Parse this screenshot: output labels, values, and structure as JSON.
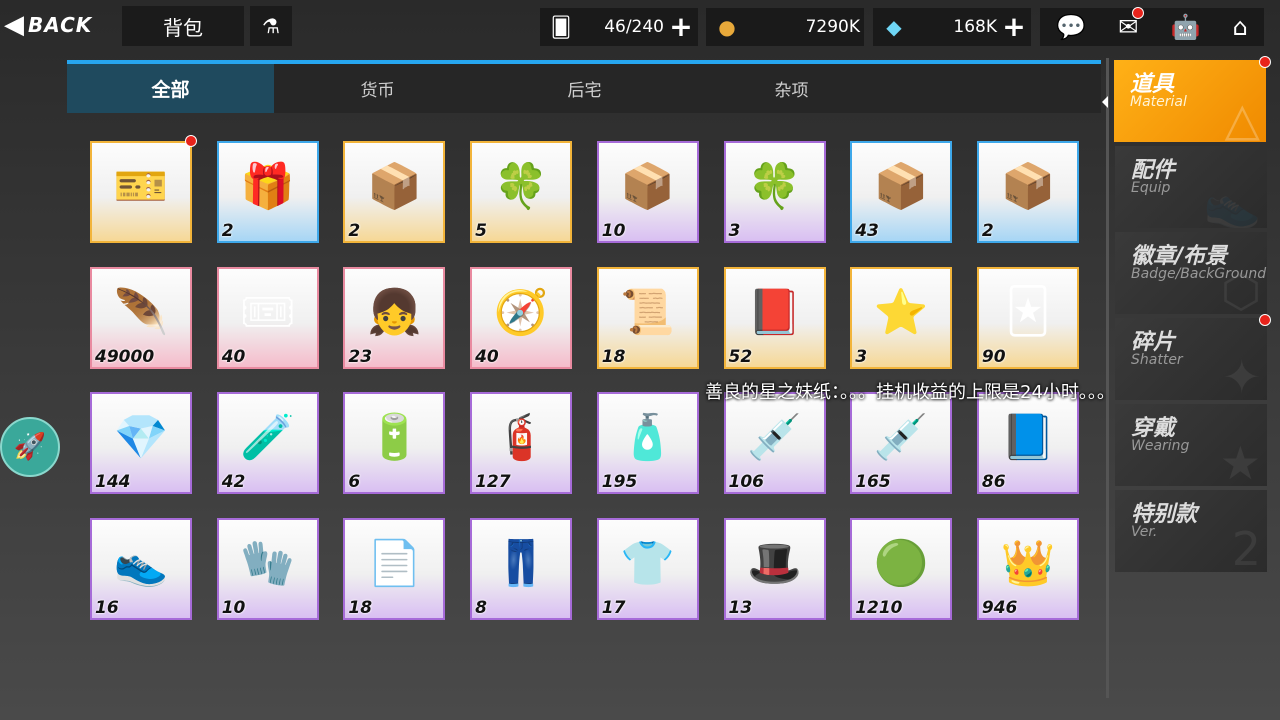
{
  "header": {
    "back_label": "BACK",
    "title": "背包",
    "flask_icon": "flask-icon"
  },
  "resources": [
    {
      "icon": "cards-icon",
      "value": "46/240"
    },
    {
      "icon": "coin-icon",
      "value": "7290K"
    },
    {
      "icon": "diamond-icon",
      "value": "168K"
    }
  ],
  "tabs": [
    {
      "label": "全部",
      "active": true
    },
    {
      "label": "货币",
      "active": false
    },
    {
      "label": "后宅",
      "active": false
    },
    {
      "label": "杂项",
      "active": false
    }
  ],
  "sidebar": [
    {
      "zh": "道具",
      "en": "Material",
      "active": true,
      "badge": true
    },
    {
      "zh": "配件",
      "en": "Equip",
      "active": false,
      "badge": false
    },
    {
      "zh": "徽章/布景",
      "en": "Badge/BackGround",
      "active": false,
      "badge": false
    },
    {
      "zh": "碎片",
      "en": "Shatter",
      "active": false,
      "badge": true
    },
    {
      "zh": "穿戴",
      "en": "Wearing",
      "active": false,
      "badge": false
    },
    {
      "zh": "特别款",
      "en": "Ver.",
      "active": false,
      "badge": false
    }
  ],
  "hint_text": "善良的星之妹纸：。。。挂机收益的上限是24小时。。。",
  "items": [
    {
      "icon": "ticket-icon",
      "count": "",
      "rarity": "gold",
      "badge": true
    },
    {
      "icon": "gift-box-icon",
      "count": "2",
      "rarity": "blue"
    },
    {
      "icon": "coin-box-icon",
      "count": "2",
      "rarity": "gold"
    },
    {
      "icon": "clover-box-icon",
      "count": "5",
      "rarity": "gold"
    },
    {
      "icon": "ticket-box-icon",
      "count": "10",
      "rarity": "purple"
    },
    {
      "icon": "clover-box-icon",
      "count": "3",
      "rarity": "purple"
    },
    {
      "icon": "ticket-box-icon",
      "count": "43",
      "rarity": "blue"
    },
    {
      "icon": "coin-box-icon",
      "count": "2",
      "rarity": "blue"
    },
    {
      "icon": "feather-icon",
      "count": "49000",
      "rarity": "pink"
    },
    {
      "icon": "pass-card-icon",
      "count": "40",
      "rarity": "pink"
    },
    {
      "icon": "figure-story-icon",
      "count": "23",
      "rarity": "pink"
    },
    {
      "icon": "compass-icon",
      "count": "40",
      "rarity": "pink"
    },
    {
      "icon": "badge-scroll-icon",
      "count": "18",
      "rarity": "gold"
    },
    {
      "icon": "book-icon",
      "count": "52",
      "rarity": "gold"
    },
    {
      "icon": "star-medal-icon",
      "count": "3",
      "rarity": "gold"
    },
    {
      "icon": "card-icon",
      "count": "90",
      "rarity": "gold"
    },
    {
      "icon": "crystal-icon",
      "count": "144",
      "rarity": "purple"
    },
    {
      "icon": "canister-icon",
      "count": "42",
      "rarity": "purple"
    },
    {
      "icon": "battery-icon",
      "count": "6",
      "rarity": "purple"
    },
    {
      "icon": "red-canister-icon",
      "count": "127",
      "rarity": "purple"
    },
    {
      "icon": "nail-polish-icon",
      "count": "195",
      "rarity": "purple"
    },
    {
      "icon": "glue-tube-icon",
      "count": "106",
      "rarity": "purple"
    },
    {
      "icon": "syringe-icon",
      "count": "165",
      "rarity": "purple"
    },
    {
      "icon": "equipment-book-icon",
      "count": "86",
      "rarity": "purple"
    },
    {
      "icon": "shoes-manual-icon",
      "count": "16",
      "rarity": "purple"
    },
    {
      "icon": "gloves-manual-icon",
      "count": "10",
      "rarity": "purple"
    },
    {
      "icon": "other-manual-icon",
      "count": "18",
      "rarity": "purple"
    },
    {
      "icon": "pants-manual-icon",
      "count": "8",
      "rarity": "purple"
    },
    {
      "icon": "clothes-manual-icon",
      "count": "17",
      "rarity": "purple"
    },
    {
      "icon": "hats-manual-icon",
      "count": "13",
      "rarity": "purple"
    },
    {
      "icon": "teal-orb-icon",
      "count": "1210",
      "rarity": "purple"
    },
    {
      "icon": "crown-icon",
      "count": "946",
      "rarity": "purple"
    }
  ]
}
